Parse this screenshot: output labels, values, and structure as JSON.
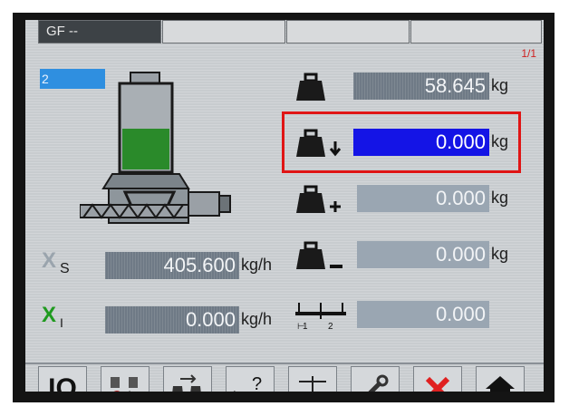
{
  "header": {
    "tabs": [
      {
        "label": "GF --"
      },
      {
        "label": ""
      },
      {
        "label": ""
      },
      {
        "label": ""
      }
    ],
    "page_indicator": "1/1"
  },
  "position_number": "2",
  "weights": {
    "actual": {
      "value": "58.645",
      "unit": "kg"
    },
    "refill": {
      "value": "0.000",
      "unit": "kg"
    },
    "plus": {
      "value": "0.000",
      "unit": "kg"
    },
    "minus": {
      "value": "0.000",
      "unit": "kg"
    },
    "ratio": {
      "value": "0.000"
    }
  },
  "flows": {
    "setpoint": {
      "symbol_sub": "S",
      "value": "405.600",
      "unit": "kg/h"
    },
    "actual": {
      "symbol_sub": "I",
      "value": "0.000",
      "unit": "kg/h"
    }
  },
  "ratio_labels": {
    "left": "1",
    "right": "2"
  },
  "toolbar": {
    "mode_label": "IO",
    "buttons": [
      "mode-button",
      "dosing-config-button",
      "swap-weight-button",
      "help-flow-button",
      "calibrate-button",
      "tools-button",
      "cancel-button",
      "home-button"
    ]
  },
  "colors": {
    "highlight": "#1414e6",
    "cancel": "#e02020",
    "material": "#2a8a2a"
  }
}
